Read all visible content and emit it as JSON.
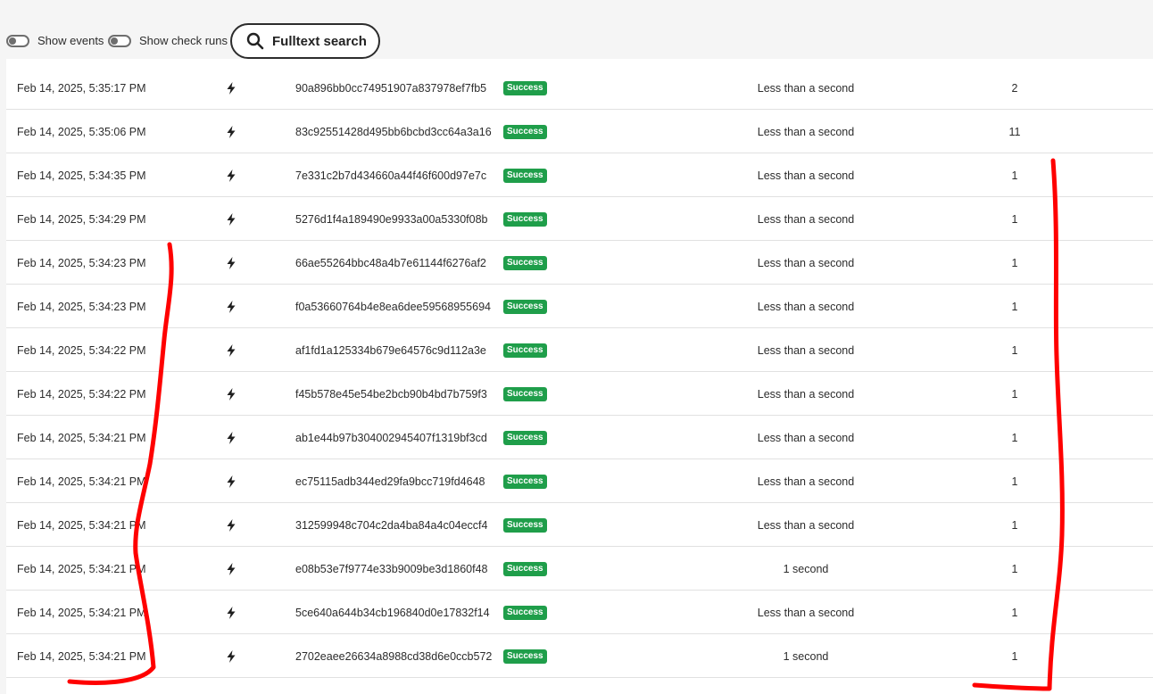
{
  "toolbar": {
    "show_events_label": "Show events",
    "show_check_runs_label": "Show check runs",
    "search_label": "Fulltext search",
    "show_events_on": false,
    "show_check_runs_on": false
  },
  "icons": {
    "search": "search-icon",
    "event": "lightning-bolt-icon"
  },
  "colors": {
    "success_badge": "#1f9e4a",
    "annotation": "#ff0000"
  },
  "rows": [
    {
      "date": "Feb 14, 2025, 5:35:17 PM",
      "hash": "90a896bb0cc74951907a837978ef7fb5",
      "status": "Success",
      "duration": "Less than a second",
      "count": "2"
    },
    {
      "date": "Feb 14, 2025, 5:35:06 PM",
      "hash": "83c92551428d495bb6bcbd3cc64a3a16",
      "status": "Success",
      "duration": "Less than a second",
      "count": "11"
    },
    {
      "date": "Feb 14, 2025, 5:34:35 PM",
      "hash": "7e331c2b7d434660a44f46f600d97e7c",
      "status": "Success",
      "duration": "Less than a second",
      "count": "1"
    },
    {
      "date": "Feb 14, 2025, 5:34:29 PM",
      "hash": "5276d1f4a189490e9933a00a5330f08b",
      "status": "Success",
      "duration": "Less than a second",
      "count": "1"
    },
    {
      "date": "Feb 14, 2025, 5:34:23 PM",
      "hash": "66ae55264bbc48a4b7e61144f6276af2",
      "status": "Success",
      "duration": "Less than a second",
      "count": "1"
    },
    {
      "date": "Feb 14, 2025, 5:34:23 PM",
      "hash": "f0a53660764b4e8ea6dee59568955694",
      "status": "Success",
      "duration": "Less than a second",
      "count": "1"
    },
    {
      "date": "Feb 14, 2025, 5:34:22 PM",
      "hash": "af1fd1a125334b679e64576c9d112a3e",
      "status": "Success",
      "duration": "Less than a second",
      "count": "1"
    },
    {
      "date": "Feb 14, 2025, 5:34:22 PM",
      "hash": "f45b578e45e54be2bcb90b4bd7b759f3",
      "status": "Success",
      "duration": "Less than a second",
      "count": "1"
    },
    {
      "date": "Feb 14, 2025, 5:34:21 PM",
      "hash": "ab1e44b97b304002945407f1319bf3cd",
      "status": "Success",
      "duration": "Less than a second",
      "count": "1"
    },
    {
      "date": "Feb 14, 2025, 5:34:21 PM",
      "hash": "ec75115adb344ed29fa9bcc719fd4648",
      "status": "Success",
      "duration": "Less than a second",
      "count": "1"
    },
    {
      "date": "Feb 14, 2025, 5:34:21 PM",
      "hash": "312599948c704c2da4ba84a4c04eccf4",
      "status": "Success",
      "duration": "Less than a second",
      "count": "1"
    },
    {
      "date": "Feb 14, 2025, 5:34:21 PM",
      "hash": "e08b53e7f9774e33b9009be3d1860f48",
      "status": "Success",
      "duration": "1 second",
      "count": "1"
    },
    {
      "date": "Feb 14, 2025, 5:34:21 PM",
      "hash": "5ce640a644b34cb196840d0e17832f14",
      "status": "Success",
      "duration": "Less than a second",
      "count": "1"
    },
    {
      "date": "Feb 14, 2025, 5:34:21 PM",
      "hash": "2702eaee26634a8988cd38d6e0ccb572",
      "status": "Success",
      "duration": "1 second",
      "count": "1"
    }
  ]
}
